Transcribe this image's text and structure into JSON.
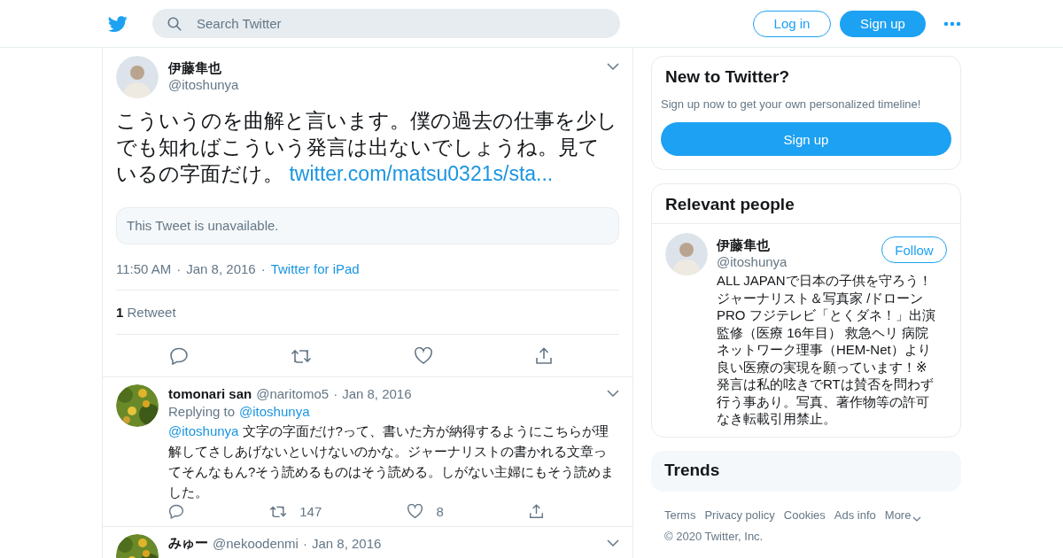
{
  "header": {
    "search_placeholder": "Search Twitter",
    "login": "Log in",
    "signup": "Sign up"
  },
  "tweet": {
    "name": "伊藤隼也",
    "handle": "@itoshunya",
    "text": "こういうのを曲解と言います。僕の過去の仕事を少しでも知ればこういう発言は出ないでしょうね。見ているの字面だけ。",
    "link": "twitter.com/matsu0321s/sta...",
    "quote": "This Tweet is unavailable.",
    "time": "11:50 AM",
    "separator": "·",
    "date": "Jan 8, 2016",
    "source": "Twitter for iPad",
    "retweet_count": "1",
    "retweet_label": "Retweet"
  },
  "replies": [
    {
      "name": "tomonari san",
      "handle": "@naritomo5",
      "date": "Jan 8, 2016",
      "replying_label": "Replying to",
      "replying_to": "@itoshunya",
      "mention": "@itoshunya",
      "text": "文字の字面だけ?って、書いた方が納得するようにこちらが理解してさしあげないといけないのかな。ジャーナリストの書かれる文章ってそんなもん?そう読めるものはそう読める。しがない主婦にもそう読めました。",
      "retweets": "147",
      "likes": "8",
      "separator": "·"
    },
    {
      "name": "みゅー",
      "handle": "@nekoodenmi",
      "separator": "·",
      "date": "Jan 8, 2016"
    }
  ],
  "sidebar": {
    "new": {
      "title": "New to Twitter?",
      "subtitle": "Sign up now to get your own personalized timeline!",
      "button": "Sign up"
    },
    "relevant": {
      "title": "Relevant people",
      "name": "伊藤隼也",
      "handle": "@itoshunya",
      "follow": "Follow",
      "bio": "ALL JAPANで日本の子供を守ろう！ジャーナリスト＆写真家 /ドローンPRO フジテレビ「とくダネ！」出演監修（医療 16年目） 救急ヘリ 病院ネットワーク理事（HEM-Net）より良い医療の実現を願っています！※ 発言は私的呟きでRTは賛否を問わず行う事あり。写真、著作物等の許可なき転載引用禁止。"
    },
    "trends": {
      "title": "Trends"
    },
    "footer_links": [
      "Terms",
      "Privacy policy",
      "Cookies",
      "Ads info",
      "More"
    ],
    "copyright": "© 2020 Twitter, Inc."
  }
}
